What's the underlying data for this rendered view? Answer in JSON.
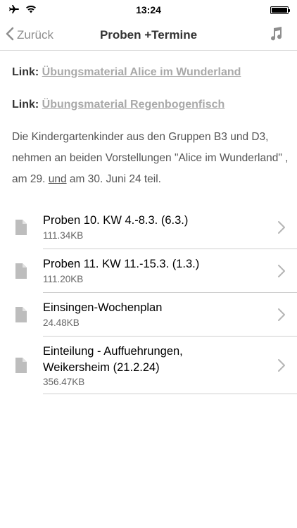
{
  "status_bar": {
    "time": "13:24",
    "icons": [
      "airplane-icon",
      "wifi-icon",
      "battery-icon"
    ]
  },
  "nav": {
    "back_label": "Zurück",
    "title": "Proben +Termine",
    "right_icon": "music-note-icon"
  },
  "links": [
    {
      "label": "Link:",
      "text": "Übungsmaterial Alice im Wunderland"
    },
    {
      "label": "Link:",
      "text": "Übungsmaterial Regenbogenfisch"
    }
  ],
  "description": {
    "part1": "Die Kindergartenkinder aus den Gruppen B3 und D3, nehmen an beiden Vorstellungen \"Alice im Wunderland\" , am 29. ",
    "underlined": "und",
    "part2": " am 30. Juni 24 teil."
  },
  "files": [
    {
      "title_line1": "Proben 10. KW 4.-8.3. (6.3.)",
      "title_line2": "",
      "size": "111.34KB"
    },
    {
      "title_line1": "Proben 11. KW 11.-15.3. (1.3.)",
      "title_line2": "",
      "size": "111.20KB"
    },
    {
      "title_line1": "Einsingen-Wochenplan",
      "title_line2": "",
      "size": "24.48KB"
    },
    {
      "title_line1": "Einteilung - Auffuehrungen,",
      "title_line2": "Weikersheim (21.2.24)",
      "size": "356.47KB"
    }
  ],
  "colors": {
    "link_gray": "#a9a9a9",
    "divider": "#cfcfcf",
    "nav_border": "#d6d6d6"
  }
}
